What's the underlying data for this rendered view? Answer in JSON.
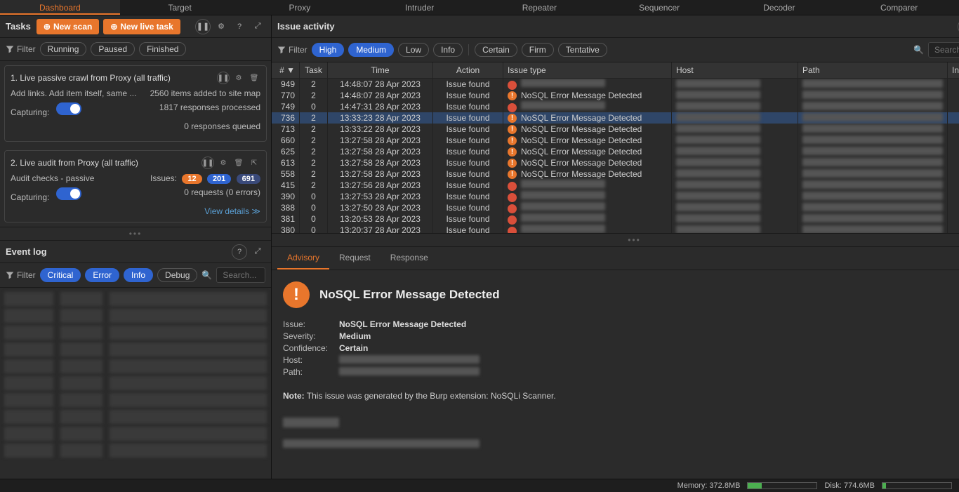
{
  "main_tabs": [
    "Dashboard",
    "Target",
    "Proxy",
    "Intruder",
    "Repeater",
    "Sequencer",
    "Decoder",
    "Comparer"
  ],
  "active_tab": 0,
  "tasks": {
    "title": "Tasks",
    "new_scan": "New scan",
    "new_live": "New live task",
    "filter_label": "Filter",
    "filters": [
      "Running",
      "Paused",
      "Finished"
    ],
    "card1": {
      "title": "1. Live passive crawl from Proxy (all traffic)",
      "line_a_left": "Add links. Add item itself, same ...",
      "line_a_right": "2560 items added to site map",
      "line_b_left": "Capturing:",
      "line_b_right": "1817 responses processed",
      "line_c_right": "0 responses queued"
    },
    "card2": {
      "title": "2. Live audit from Proxy (all traffic)",
      "sub_left": "Audit checks - passive",
      "sub_right": "Issues:",
      "badges": [
        "12",
        "201",
        "691"
      ],
      "cap": "Capturing:",
      "req": "0 requests (0 errors)",
      "view": "View details ≫"
    }
  },
  "eventlog": {
    "title": "Event log",
    "filter_label": "Filter",
    "pills": [
      "Critical",
      "Error",
      "Info",
      "Debug"
    ],
    "active_pills": [
      0,
      1,
      2
    ],
    "search_ph": "Search..."
  },
  "issue": {
    "title": "Issue activity",
    "filter_label": "Filter",
    "sev_pills": [
      "High",
      "Medium",
      "Low",
      "Info"
    ],
    "sev_active": [
      0,
      1
    ],
    "conf_pills": [
      "Certain",
      "Firm",
      "Tentative"
    ],
    "search_ph": "Search...",
    "headers": [
      "# ▼",
      "Task",
      "Time",
      "Action",
      "Issue type",
      "Host",
      "Path",
      "Insertion"
    ],
    "rows": [
      {
        "n": "949",
        "t": "2",
        "time": "14:48:07 28 Apr 2023",
        "act": "Issue found",
        "type": "blur",
        "sev": "high",
        "sel": false
      },
      {
        "n": "770",
        "t": "2",
        "time": "14:48:07 28 Apr 2023",
        "act": "Issue found",
        "type": "NoSQL Error Message Detected",
        "sev": "med",
        "sel": false
      },
      {
        "n": "749",
        "t": "0",
        "time": "14:47:31 28 Apr 2023",
        "act": "Issue found",
        "type": "blur",
        "sev": "high",
        "sel": false
      },
      {
        "n": "736",
        "t": "2",
        "time": "13:33:23 28 Apr 2023",
        "act": "Issue found",
        "type": "NoSQL Error Message Detected",
        "sev": "med",
        "sel": true
      },
      {
        "n": "713",
        "t": "2",
        "time": "13:33:22 28 Apr 2023",
        "act": "Issue found",
        "type": "NoSQL Error Message Detected",
        "sev": "med",
        "sel": false
      },
      {
        "n": "660",
        "t": "2",
        "time": "13:27:58 28 Apr 2023",
        "act": "Issue found",
        "type": "NoSQL Error Message Detected",
        "sev": "med",
        "sel": false
      },
      {
        "n": "625",
        "t": "2",
        "time": "13:27:58 28 Apr 2023",
        "act": "Issue found",
        "type": "NoSQL Error Message Detected",
        "sev": "med",
        "sel": false
      },
      {
        "n": "613",
        "t": "2",
        "time": "13:27:58 28 Apr 2023",
        "act": "Issue found",
        "type": "NoSQL Error Message Detected",
        "sev": "med",
        "sel": false
      },
      {
        "n": "558",
        "t": "2",
        "time": "13:27:58 28 Apr 2023",
        "act": "Issue found",
        "type": "NoSQL Error Message Detected",
        "sev": "med",
        "sel": false
      },
      {
        "n": "415",
        "t": "2",
        "time": "13:27:56 28 Apr 2023",
        "act": "Issue found",
        "type": "blur",
        "sev": "high",
        "sel": false
      },
      {
        "n": "390",
        "t": "0",
        "time": "13:27:53 28 Apr 2023",
        "act": "Issue found",
        "type": "blur",
        "sev": "high",
        "sel": false
      },
      {
        "n": "388",
        "t": "0",
        "time": "13:27:50 28 Apr 2023",
        "act": "Issue found",
        "type": "blur",
        "sev": "high",
        "sel": false
      },
      {
        "n": "381",
        "t": "0",
        "time": "13:20:53 28 Apr 2023",
        "act": "Issue found",
        "type": "blur",
        "sev": "high",
        "sel": false
      },
      {
        "n": "380",
        "t": "0",
        "time": "13:20:37 28 Apr 2023",
        "act": "Issue found",
        "type": "blur",
        "sev": "high",
        "sel": false
      }
    ]
  },
  "detail_tabs": [
    "Advisory",
    "Request",
    "Response"
  ],
  "advisory": {
    "title": "NoSQL Error Message Detected",
    "rows": [
      {
        "l": "Issue:",
        "v": "NoSQL Error Message Detected"
      },
      {
        "l": "Severity:",
        "v": "Medium"
      },
      {
        "l": "Confidence:",
        "v": "Certain"
      },
      {
        "l": "Host:",
        "v": ""
      },
      {
        "l": "Path:",
        "v": ""
      }
    ],
    "note_label": "Note:",
    "note_text": " This issue was generated by the Burp extension: NoSQLi Scanner."
  },
  "status": {
    "mem_label": "Memory: 372.8MB",
    "mem_pct": 20,
    "disk_label": "Disk: 774.6MB",
    "disk_pct": 5
  }
}
